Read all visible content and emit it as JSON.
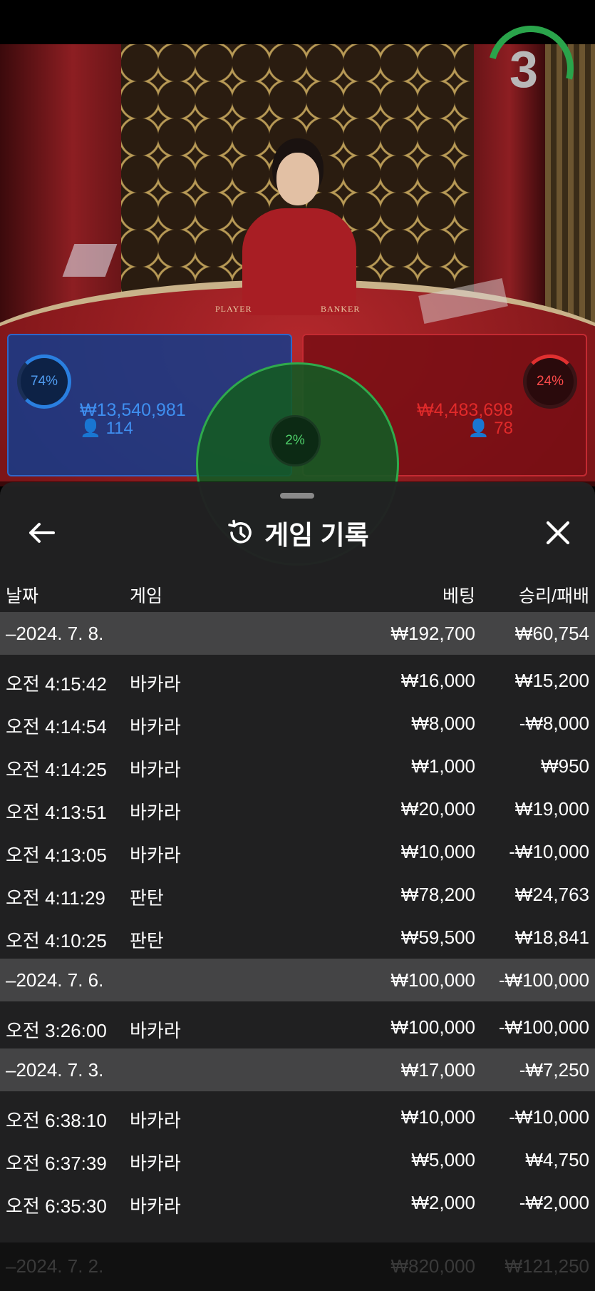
{
  "live": {
    "countdown": "3",
    "table_labels": {
      "player": "PLAYER",
      "banker": "BANKER"
    },
    "player": {
      "percent": "74%",
      "amount": "₩13,540,981",
      "users": "114"
    },
    "banker": {
      "percent": "24%",
      "amount": "₩4,483,698",
      "users": "78"
    },
    "tie": {
      "percent": "2%"
    },
    "colors": {
      "player": "#2f66c8",
      "banker": "#c42a32",
      "tie": "#2faa4c"
    }
  },
  "history": {
    "title": "게임 기록",
    "icons": {
      "back": "arrow-left-icon",
      "title": "history-icon",
      "close": "close-icon"
    },
    "columns": {
      "date": "날짜",
      "game": "게임",
      "bet": "베팅",
      "result": "승리/패배"
    },
    "groups": [
      {
        "date": "–2024. 7. 8.",
        "bet_total": "₩192,700",
        "result_total": "₩60,754",
        "rows": [
          {
            "time": "오전 4:15:42",
            "game": "바카라",
            "bet": "₩16,000",
            "result": "₩15,200"
          },
          {
            "time": "오전 4:14:54",
            "game": "바카라",
            "bet": "₩8,000",
            "result": "-₩8,000"
          },
          {
            "time": "오전 4:14:25",
            "game": "바카라",
            "bet": "₩1,000",
            "result": "₩950"
          },
          {
            "time": "오전 4:13:51",
            "game": "바카라",
            "bet": "₩20,000",
            "result": "₩19,000"
          },
          {
            "time": "오전 4:13:05",
            "game": "바카라",
            "bet": "₩10,000",
            "result": "-₩10,000"
          },
          {
            "time": "오전 4:11:29",
            "game": "판탄",
            "bet": "₩78,200",
            "result": "₩24,763"
          },
          {
            "time": "오전 4:10:25",
            "game": "판탄",
            "bet": "₩59,500",
            "result": "₩18,841"
          }
        ]
      },
      {
        "date": "–2024. 7. 6.",
        "bet_total": "₩100,000",
        "result_total": "-₩100,000",
        "rows": [
          {
            "time": "오전 3:26:00",
            "game": "바카라",
            "bet": "₩100,000",
            "result": "-₩100,000"
          }
        ]
      },
      {
        "date": "–2024. 7. 3.",
        "bet_total": "₩17,000",
        "result_total": "-₩7,250",
        "rows": [
          {
            "time": "오전 6:38:10",
            "game": "바카라",
            "bet": "₩10,000",
            "result": "-₩10,000"
          },
          {
            "time": "오전 6:37:39",
            "game": "바카라",
            "bet": "₩5,000",
            "result": "₩4,750"
          },
          {
            "time": "오전 6:35:30",
            "game": "바카라",
            "bet": "₩2,000",
            "result": "-₩2,000"
          }
        ]
      }
    ],
    "partial_next": {
      "date": "–2024. 7. 2.",
      "bet_total": "₩820,000",
      "result_total": "₩121,250"
    }
  }
}
